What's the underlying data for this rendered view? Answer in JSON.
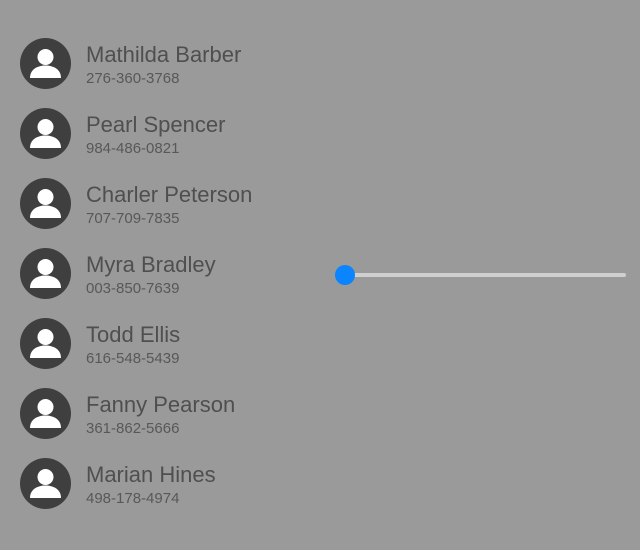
{
  "contacts": [
    {
      "name": "Mathilda Barber",
      "phone": "276-360-3768",
      "icon": "person-icon"
    },
    {
      "name": "Pearl Spencer",
      "phone": "984-486-0821",
      "icon": "person-icon"
    },
    {
      "name": "Charler Peterson",
      "phone": "707-709-7835",
      "icon": "person-icon"
    },
    {
      "name": "Myra Bradley",
      "phone": "003-850-7639",
      "icon": "person-icon"
    },
    {
      "name": "Todd Ellis",
      "phone": "616-548-5439",
      "icon": "person-icon"
    },
    {
      "name": "Fanny Pearson",
      "phone": "361-862-5666",
      "icon": "person-icon"
    },
    {
      "name": "Marian Hines",
      "phone": "498-178-4974",
      "icon": "person-icon"
    }
  ],
  "slider": {
    "value": 0.0,
    "min": 0,
    "max": 1
  },
  "colors": {
    "background": "#9a9a9a",
    "avatar": "#3f3f3f",
    "accent": "#0a84ff",
    "track": "#cfcfcf",
    "name_text": "#4f4f4f",
    "phone_text": "#585858"
  }
}
